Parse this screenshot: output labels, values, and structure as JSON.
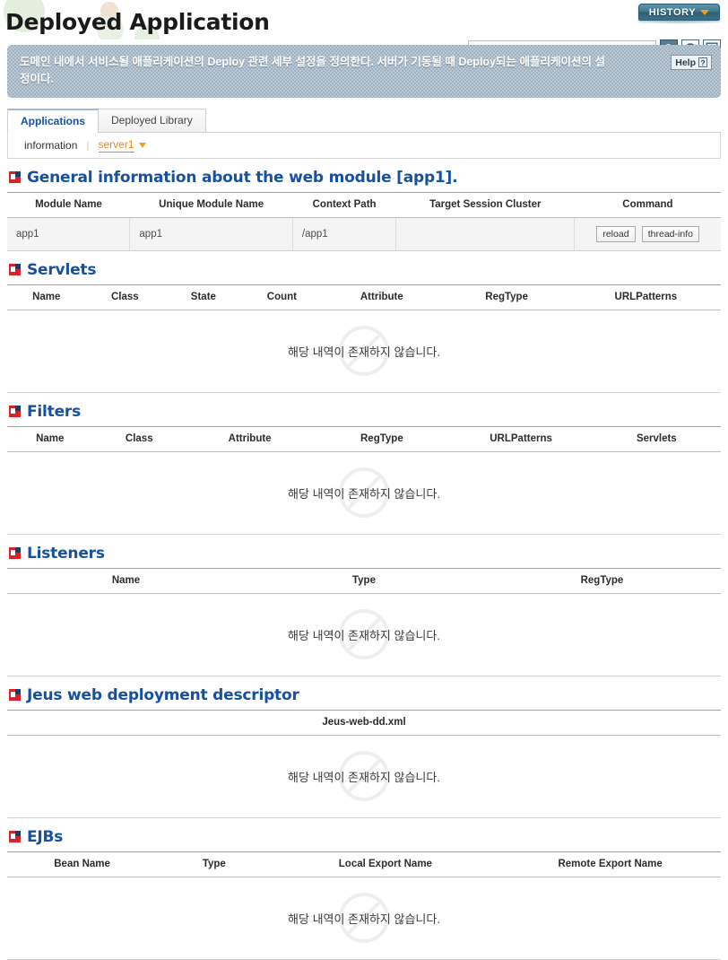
{
  "header": {
    "title": "Deployed Application",
    "history_label": "HISTORY",
    "search_placeholder": "",
    "search_value": "",
    "icons": {
      "search": "search-icon",
      "refresh": "refresh-icon",
      "xml_export": "xml-export-icon"
    }
  },
  "description": {
    "text": "도메인 내에서 서비스될 애플리케이션의 Deploy 관련 세부 설정을 정의한다. 서버가 기동될 때 Deploy되는 애플리케이션의 설정이다.",
    "help_label": "Help",
    "help_mark": "?"
  },
  "tabs": [
    {
      "label": "Applications",
      "active": true
    },
    {
      "label": "Deployed Library",
      "active": false
    }
  ],
  "subbar": {
    "info_label": "information",
    "separator": "|",
    "server_label": "server1"
  },
  "empty_message": "해당 내역이 존재하지 않습니다.",
  "sections": [
    {
      "title": "General information about the web module [app1].",
      "columns": [
        "Module Name",
        "Unique Module Name",
        "Context Path",
        "Target Session Cluster",
        "Command"
      ],
      "rows": [
        {
          "module_name": "app1",
          "unique_module_name": "app1",
          "context_path": "/app1",
          "target_session_cluster": "",
          "commands": [
            "reload",
            "thread-info"
          ]
        }
      ]
    },
    {
      "title": "Servlets",
      "columns": [
        "Name",
        "Class",
        "State",
        "Count",
        "Attribute",
        "RegType",
        "URLPatterns"
      ],
      "rows": []
    },
    {
      "title": "Filters",
      "columns": [
        "Name",
        "Class",
        "Attribute",
        "RegType",
        "URLPatterns",
        "Servlets"
      ],
      "rows": []
    },
    {
      "title": "Listeners",
      "columns": [
        "Name",
        "Type",
        "RegType"
      ],
      "rows": []
    },
    {
      "title": "Jeus web deployment descriptor",
      "columns": [
        "Jeus-web-dd.xml"
      ],
      "rows": []
    },
    {
      "title": "EJBs",
      "columns": [
        "Bean Name",
        "Type",
        "Local Export Name",
        "Remote Export Name"
      ],
      "rows": []
    }
  ],
  "colors": {
    "accent_blue": "#15519e",
    "accent_orange": "#e08c1a",
    "icon_red": "#d8232a",
    "icon_navy": "#15406e",
    "banner_bg": "#9fb2c2",
    "history_teal": "#41788e"
  }
}
